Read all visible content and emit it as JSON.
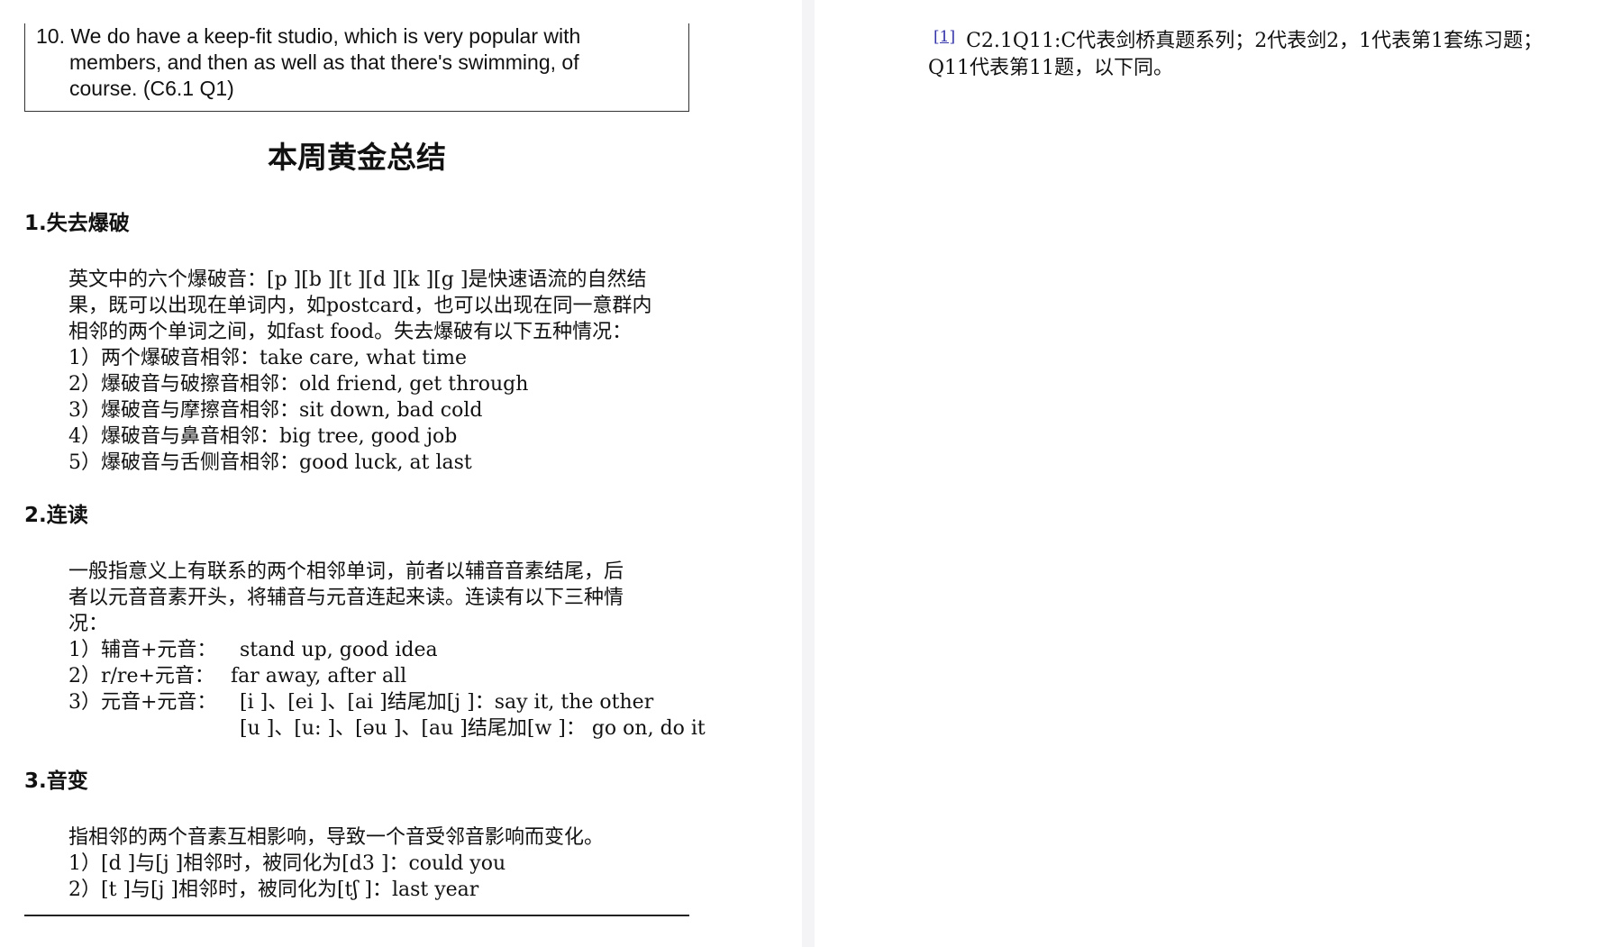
{
  "quote": {
    "number": "10.",
    "lines": [
      "We do have a keep-fit studio, which is very popular with",
      "members, and then as well as that there's swimming, of",
      "course. (C6.1 Q1)"
    ]
  },
  "title": "本周黄金总结",
  "sections": [
    {
      "heading": "1.失去爆破",
      "intro": [
        "英文中的六个爆破音：[p ][b ][t ][d ][k ][g ]是快速语流的自然结",
        "果，既可以出现在单词内，如postcard，也可以出现在同一意群内",
        "相邻的两个单词之间，如fast food。失去爆破有以下五种情况："
      ],
      "items": [
        "1）两个爆破音相邻：take care, what time",
        "2）爆破音与破擦音相邻：old friend, get through",
        "3）爆破音与摩擦音相邻：sit down, bad cold",
        "4）爆破音与鼻音相邻：big tree, good job",
        "5）爆破音与舌侧音相邻：good luck, at last"
      ]
    },
    {
      "heading": "2.连读",
      "intro": [
        "一般指意义上有联系的两个相邻单词，前者以辅音音素结尾，后",
        "者以元音音素开头，将辅音与元音连起来读。连读有以下三种情",
        "况："
      ],
      "items": [
        {
          "label": "1）辅音+元音：",
          "text": "stand up, good idea"
        },
        {
          "label": "2）r/re+元音：",
          "text": "far away, after all"
        },
        {
          "label": "3）元音+元音：",
          "text": "[i ]、[ei ]、[ai ]结尾加[j ]：say it, the other"
        },
        {
          "label": "",
          "text": "[u ]、[u: ]、[əu ]、[au ]结尾加[w ]： go on, do it"
        }
      ]
    },
    {
      "heading": "3.音变",
      "intro": [
        "指相邻的两个音素互相影响，导致一个音受邻音影响而变化。"
      ],
      "items": [
        "1）[d ]与[j ]相邻时，被同化为[d3 ]：could you",
        "2）[t ]与[j ]相邻时，被同化为[tʃ ]：last year"
      ]
    }
  ],
  "footnote": {
    "ref": "[1]",
    "lines": [
      "C2.1Q11:C代表剑桥真题系列；2代表剑2，1代表第1套练习题；",
      "Q11代表第11题，以下同。"
    ]
  }
}
